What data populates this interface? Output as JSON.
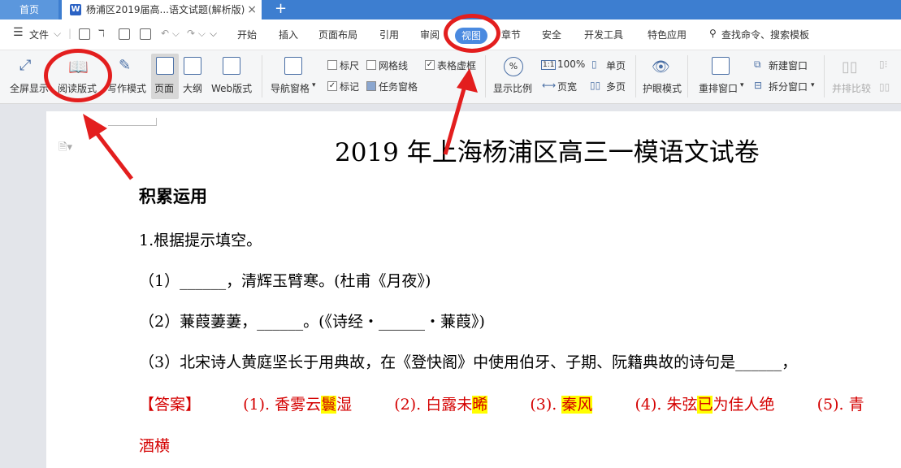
{
  "tabs": {
    "home": "首页",
    "doc_title": "杨浦区2019届高...语文试题(解析版)",
    "close": "×",
    "add": "+"
  },
  "menu": {
    "file": "文件",
    "items": [
      "开始",
      "插入",
      "页面布局",
      "引用",
      "审阅",
      "视图",
      "章节",
      "安全",
      "开发工具",
      "特色应用"
    ],
    "search": "查找命令、搜索模板"
  },
  "ribbon": {
    "fullscreen": "全屏显示",
    "reading": "阅读版式",
    "writing": "写作模式",
    "page": "页面",
    "outline": "大纲",
    "web": "Web版式",
    "nav_pane": "导航窗格",
    "ruler": "标尺",
    "gridlines": "网格线",
    "table_dotted": "表格虚框",
    "marks": "标记",
    "task_pane": "任务窗格",
    "zoom_ratio": "显示比例",
    "zoom_100": "100%",
    "page_width": "页宽",
    "single_page": "单页",
    "multi_page": "多页",
    "eye_mode": "护眼模式",
    "rearrange": "重排窗口",
    "new_window": "新建窗口",
    "split_window": "拆分窗口",
    "side_by_side": "并排比较"
  },
  "document": {
    "title": "2019 年上海杨浦区高三一模语文试卷",
    "section": "积累运用",
    "q1": "1.根据提示填空。",
    "q1_1": "（1）______，清辉玉臂寒。(杜甫《月夜》)",
    "q1_2": "（2）蒹葭萋萋，______。(《诗经・______・蒹葭》)",
    "q1_3": "（3）北宋诗人黄庭坚长于用典故，在《登快阁》中使用伯牙、子期、阮籍典故的诗句是______，",
    "answer_label": "【答案】",
    "a1_pre": "(1). 香雾云",
    "a1_hl": "鬟",
    "a1_post": "湿",
    "a2_pre": "(2). 白露未",
    "a2_hl": "晞",
    "a3_pre": "(3). ",
    "a3_hl": "秦风",
    "a4_pre": "(4). 朱弦",
    "a4_hl": "已",
    "a4_post": "为佳人绝",
    "a5_pre": "(5). 青",
    "answer_cont": "酒横"
  }
}
